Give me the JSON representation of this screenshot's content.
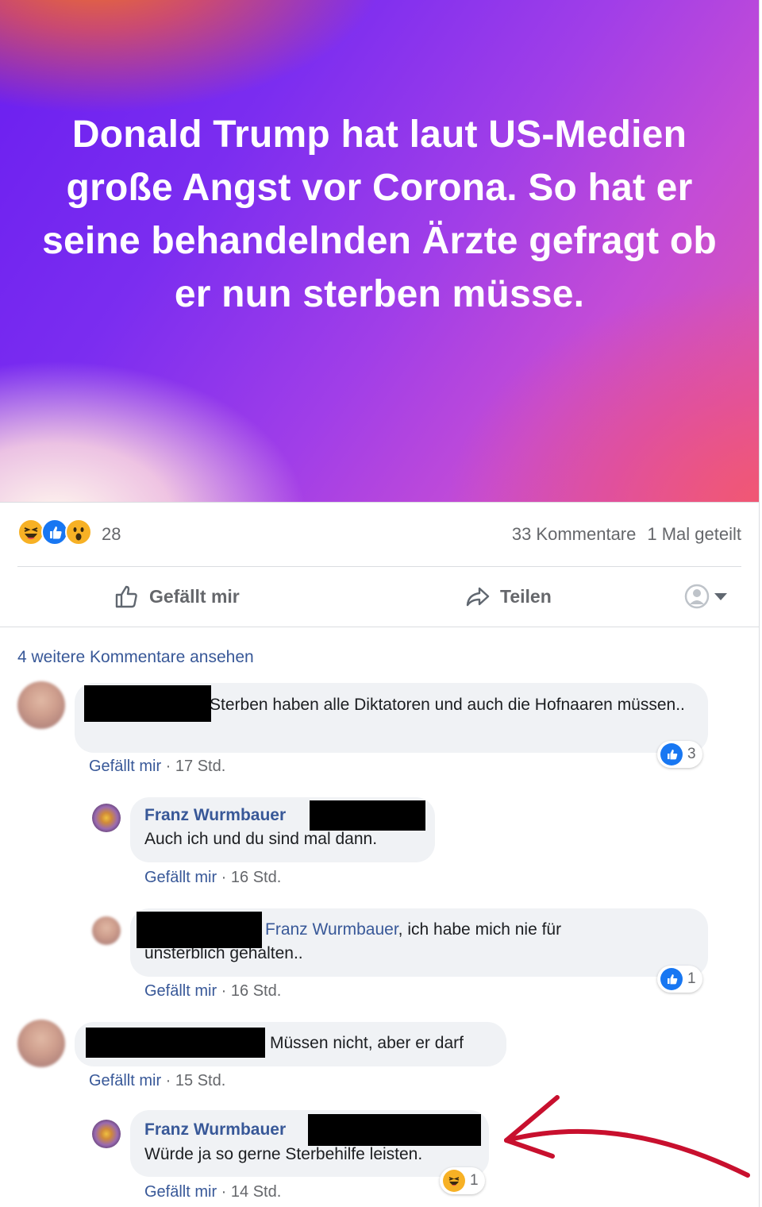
{
  "post": {
    "headline": "Donald Trump hat laut US-Medien große Angst vor Corona. So hat er seine behandelnden Ärzte gefragt ob er nun sterben müsse.",
    "reaction_count": "28",
    "comments_count": "33 Kommentare",
    "shares_count": "1 Mal geteilt",
    "like_label": "Gefällt mir",
    "share_label": "Teilen"
  },
  "comments_section": {
    "more_comments": "4 weitere Kommentare ansehen",
    "comments": [
      {
        "text": "Sterben haben alle Diktatoren und auch die Hofnaaren müssen..",
        "like_label": "Gefällt mir",
        "time": "17 Std.",
        "reactions": "3",
        "replies": [
          {
            "author": "Franz Wurmbauer",
            "text": "Auch ich und du sind mal dann.",
            "like_label": "Gefällt mir",
            "time": "16 Std."
          },
          {
            "mention": "Franz Wurmbauer",
            "text": ", ich habe mich nie für unsterblich gehalten..",
            "like_label": "Gefällt mir",
            "time": "16 Std.",
            "reactions": "1"
          }
        ]
      },
      {
        "text": "Müssen nicht, aber er darf",
        "like_label": "Gefällt mir",
        "time": "15 Std.",
        "replies": [
          {
            "author": "Franz Wurmbauer",
            "text": "Würde ja so gerne Sterbehilfe leisten.",
            "like_label": "Gefällt mir",
            "time": "14 Std.",
            "reactions": "1"
          }
        ]
      }
    ]
  },
  "colors": {
    "link": "#385898",
    "like_blue": "#1877f2",
    "annotation_arrow": "#c8102e"
  },
  "icons": [
    "haha-reaction-icon",
    "like-reaction-icon",
    "wow-reaction-icon",
    "thumbs-up-icon",
    "share-arrow-icon",
    "profile-avatar-icon",
    "chevron-down-icon",
    "red-annotation-arrow"
  ]
}
